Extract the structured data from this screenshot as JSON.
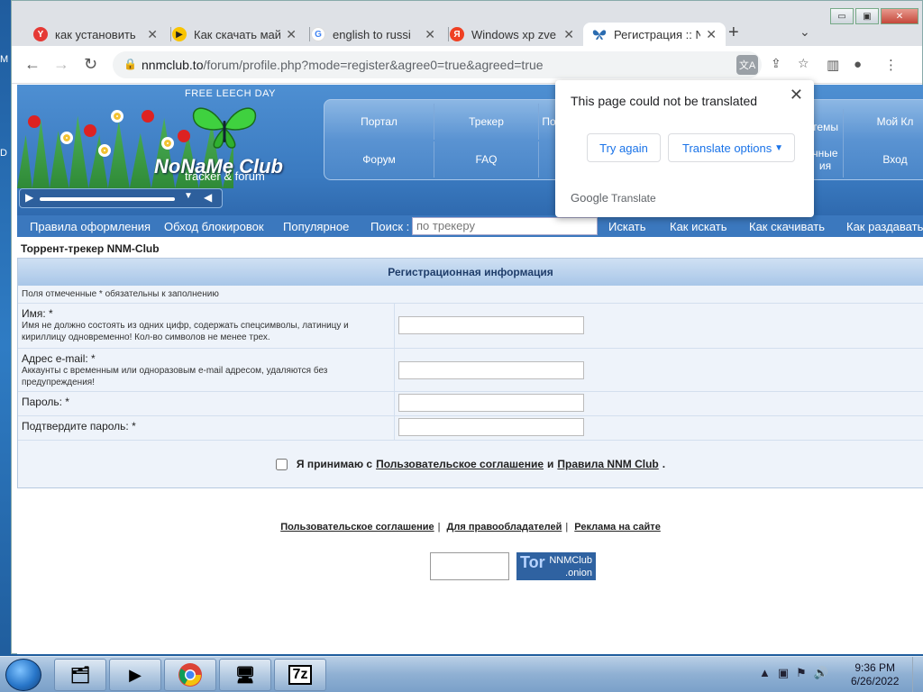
{
  "browser": {
    "tabs": [
      {
        "label": "как установить",
        "icon": "Y",
        "icon_color": "#e53935",
        "active": false
      },
      {
        "label": "Как скачать май",
        "icon": "▶",
        "icon_color": "#f9c400",
        "active": false
      },
      {
        "label": "english to russi",
        "icon": "G",
        "icon_color": "#4285f4",
        "active": false
      },
      {
        "label": "Windows xp zve",
        "icon": "Я",
        "icon_color": "#ef4023",
        "active": false
      },
      {
        "label": "Регистрация :: N",
        "icon": "butterfly",
        "icon_color": "#2b6cb0",
        "active": true
      }
    ],
    "url_host": "nnmclub.to",
    "url_path": "/forum/profile.php?mode=register&agree0=true&agreed=true",
    "window_controls": {
      "minimize": "▭",
      "maximize": "▣",
      "close": "✕"
    }
  },
  "translate_popup": {
    "message": "This page could not be translated",
    "try_again": "Try again",
    "options": "Translate options",
    "footer_brand": "Google",
    "footer_product": "Translate"
  },
  "site": {
    "free_leech": "FREE LEECH DAY",
    "brand": "NoNaMe Club",
    "brand_sub": "tracker & forum",
    "nav": {
      "row1": [
        "Портал",
        "Трекер",
        "По",
        "темы",
        "Мой Кл"
      ],
      "row2": [
        "Форум",
        "FAQ",
        "чные\nия",
        "Вход"
      ]
    },
    "subnav": {
      "rules": "Правила оформления",
      "bypass": "Обход блокировок",
      "popular": "Популярное",
      "search_label": "Поиск :",
      "search_placeholder": "по трекеру",
      "search_btn": "Искать",
      "how_search": "Как искать",
      "how_download": "Как скачивать",
      "how_seed": "Как раздавать"
    },
    "breadcrumb": "Торрент-трекер NNM-Club"
  },
  "form": {
    "title": "Регистрационная информация",
    "note": "Поля отмеченные * обязательны к заполнению",
    "fields": [
      {
        "label": "Имя: *",
        "hint": "Имя не должно состоять из одних цифр, содержать спецсимволы, латиницу и кириллицу одновременно! Кол-во символов не менее трех."
      },
      {
        "label": "Адрес e-mail: *",
        "hint": "Аккаунты с временным или одноразовым e-mail адресом, удаляются без предупреждения!"
      },
      {
        "label": "Пароль: *",
        "hint": ""
      },
      {
        "label": "Подтвердите пароль: *",
        "hint": ""
      }
    ],
    "accept_prefix": "Я принимаю с",
    "accept_link1": "Пользовательское соглашение",
    "accept_and": "и",
    "accept_link2": "Правила NNM Club",
    "accept_suffix": "."
  },
  "footer": {
    "links": [
      "Пользовательское соглашение",
      "Для правообладателей",
      "Реклама на сайте"
    ],
    "tor_badge_line1": "NNMClub",
    "tor_badge_line2": ".onion",
    "tor_letter": "Tor"
  },
  "taskbar": {
    "time": "9:36 PM",
    "date": "6/26/2022",
    "apps": [
      "file-explorer-icon",
      "media-player-icon",
      "chrome-icon",
      "network-icon",
      "7zip-icon"
    ],
    "sevenzip_label": "7z"
  },
  "desktop": {
    "edge_letter": "M",
    "edge_letter2": "D"
  }
}
